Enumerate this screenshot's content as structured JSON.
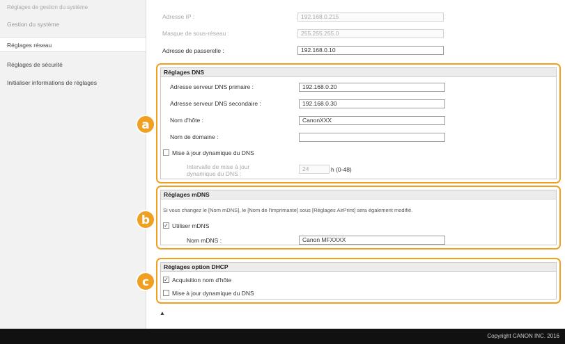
{
  "sidebar": {
    "heading": "Réglages de gestion du système",
    "items": [
      {
        "label": "Gestion du système"
      },
      {
        "label": "Réglages réseau"
      },
      {
        "label": "Réglages de sécurité"
      },
      {
        "label": "Initialiser informations de réglages"
      }
    ]
  },
  "network": {
    "ip_label": "Adresse IP :",
    "ip_value": "192.168.0.215",
    "mask_label": "Masque de sous-réseau :",
    "mask_value": "255.255.255.0",
    "gateway_label": "Adresse de passerelle :",
    "gateway_value": "192.168.0.10"
  },
  "dns": {
    "title": "Réglages DNS",
    "primary_label": "Adresse serveur DNS primaire :",
    "primary_value": "192.168.0.20",
    "secondary_label": "Adresse serveur DNS secondaire :",
    "secondary_value": "192.168.0.30",
    "host_label": "Nom d'hôte :",
    "host_value": "CanonXXX",
    "domain_label": "Nom de domaine :",
    "domain_value": "",
    "dyn_update_label": "Mise à jour dynamique du DNS",
    "dyn_update_checked": false,
    "interval_label_1": "Intervalle de mise à jour",
    "interval_label_2": "dynamique du DNS :",
    "interval_value": "24",
    "interval_unit": "h (0-48)"
  },
  "mdns": {
    "title": "Réglages mDNS",
    "note": "Si vous changez le [Nom mDNS], le [Nom de l'imprimante] sous [Réglages AirPrint] sera également modifié.",
    "use_label": "Utiliser mDNS",
    "use_checked": true,
    "name_label": "Nom mDNS :",
    "name_value": "Canon MFXXXX"
  },
  "dhcp": {
    "title": "Réglages option DHCP",
    "acq_label": "Acquisition nom d'hôte",
    "acq_checked": true,
    "dyn_label": "Mise à jour dynamique du DNS",
    "dyn_checked": false
  },
  "badges": {
    "a": "a",
    "b": "b",
    "c": "c"
  },
  "icons": {
    "check": "✓",
    "top": "▲"
  },
  "footer": {
    "copyright": "Copyright CANON INC. 2016"
  },
  "colors": {
    "accent": "#f0a020",
    "footer_bg": "#111111"
  }
}
